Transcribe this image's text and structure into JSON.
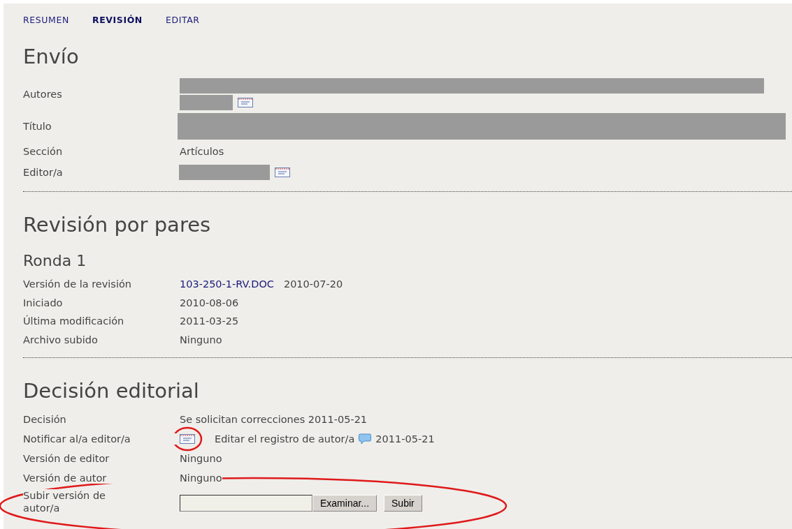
{
  "tabs": [
    {
      "label": "RESUMEN",
      "selected": false
    },
    {
      "label": "REVISIÓN",
      "selected": true
    },
    {
      "label": "EDITAR",
      "selected": false
    }
  ],
  "envio": {
    "title": "Envío",
    "rows": [
      {
        "label": "Autores",
        "kind": "redacted_authors"
      },
      {
        "label": "Título",
        "kind": "redacted_title"
      },
      {
        "label": "Sección",
        "kind": "text",
        "value": "Artículos"
      },
      {
        "label": "Editor/a",
        "kind": "redacted_email"
      }
    ]
  },
  "revision": {
    "title": "Revisión por pares",
    "round_title": "Ronda 1",
    "rows": [
      {
        "label": "Versión de la revisión",
        "kind": "file",
        "link": "103-250-1-RV.DOC",
        "value": "2010-07-20"
      },
      {
        "label": "Iniciado",
        "kind": "text",
        "value": "2010-08-06"
      },
      {
        "label": "Última modificación",
        "kind": "text",
        "value": "2011-03-25"
      },
      {
        "label": "Archivo subido",
        "kind": "text",
        "value": "Ninguno"
      }
    ]
  },
  "decision": {
    "title": "Decisión editorial",
    "rows": [
      {
        "label": "Decisión",
        "kind": "text",
        "value": "Se solicitan correcciones 2011-05-21"
      },
      {
        "label": "Notificar al/a editor/a",
        "kind": "notify",
        "circled": true,
        "link": "Editar el registro de autor/a",
        "value": "2011-05-21"
      },
      {
        "label": "Versión de editor",
        "kind": "text",
        "value": "Ninguno"
      },
      {
        "label": "Versión de autor",
        "kind": "text",
        "value": "Ninguno"
      },
      {
        "label": "Subir versión de autor/a",
        "kind": "upload",
        "circled": true,
        "browse_button": "Examinar...",
        "submit_button": "Subir"
      }
    ]
  }
}
